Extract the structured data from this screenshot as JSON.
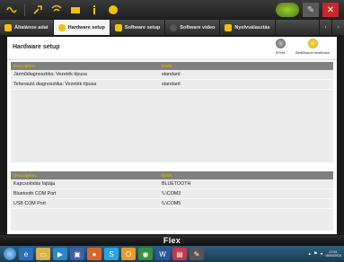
{
  "tabs": [
    {
      "label": "Általános adat",
      "color": "#f2c200"
    },
    {
      "label": "Hardware setup",
      "color": "#f2c200"
    },
    {
      "label": "Software setup",
      "color": "#f2c200"
    },
    {
      "label": "Software video",
      "color": "#f2c200"
    },
    {
      "label": "Nyelvválasztás",
      "color": "#f2c200"
    }
  ],
  "page": {
    "title": "Hardware setup",
    "btest_label": "BTest",
    "settings_label": "Beállítások beállítása"
  },
  "table1": {
    "header": {
      "col1": "Description",
      "col2": "Érték"
    },
    "rows": [
      {
        "desc": "Járműdiagnosztika: Vezeték típusa",
        "value": "standard"
      },
      {
        "desc": "Teherautó diagnosztika: Vezeték típusa",
        "value": "standard"
      }
    ]
  },
  "table2": {
    "header": {
      "col1": "Description",
      "col2": "Érték"
    },
    "rows": [
      {
        "desc": "Kapcsolódás fajtája",
        "value": "BLUETOOTH"
      },
      {
        "desc": "Bluetooth COM Port",
        "value": "\\\\.\\COM3"
      },
      {
        "desc": "USB COM Port",
        "value": "\\\\.\\COM5"
      }
    ]
  },
  "flexbar": {
    "label": "Flex"
  },
  "taskbar": {
    "time": "17:51",
    "date": "16/04/2015"
  },
  "colors": {
    "accent": "#f2c200",
    "header_text": "#d7b200",
    "close": "#c62828"
  }
}
